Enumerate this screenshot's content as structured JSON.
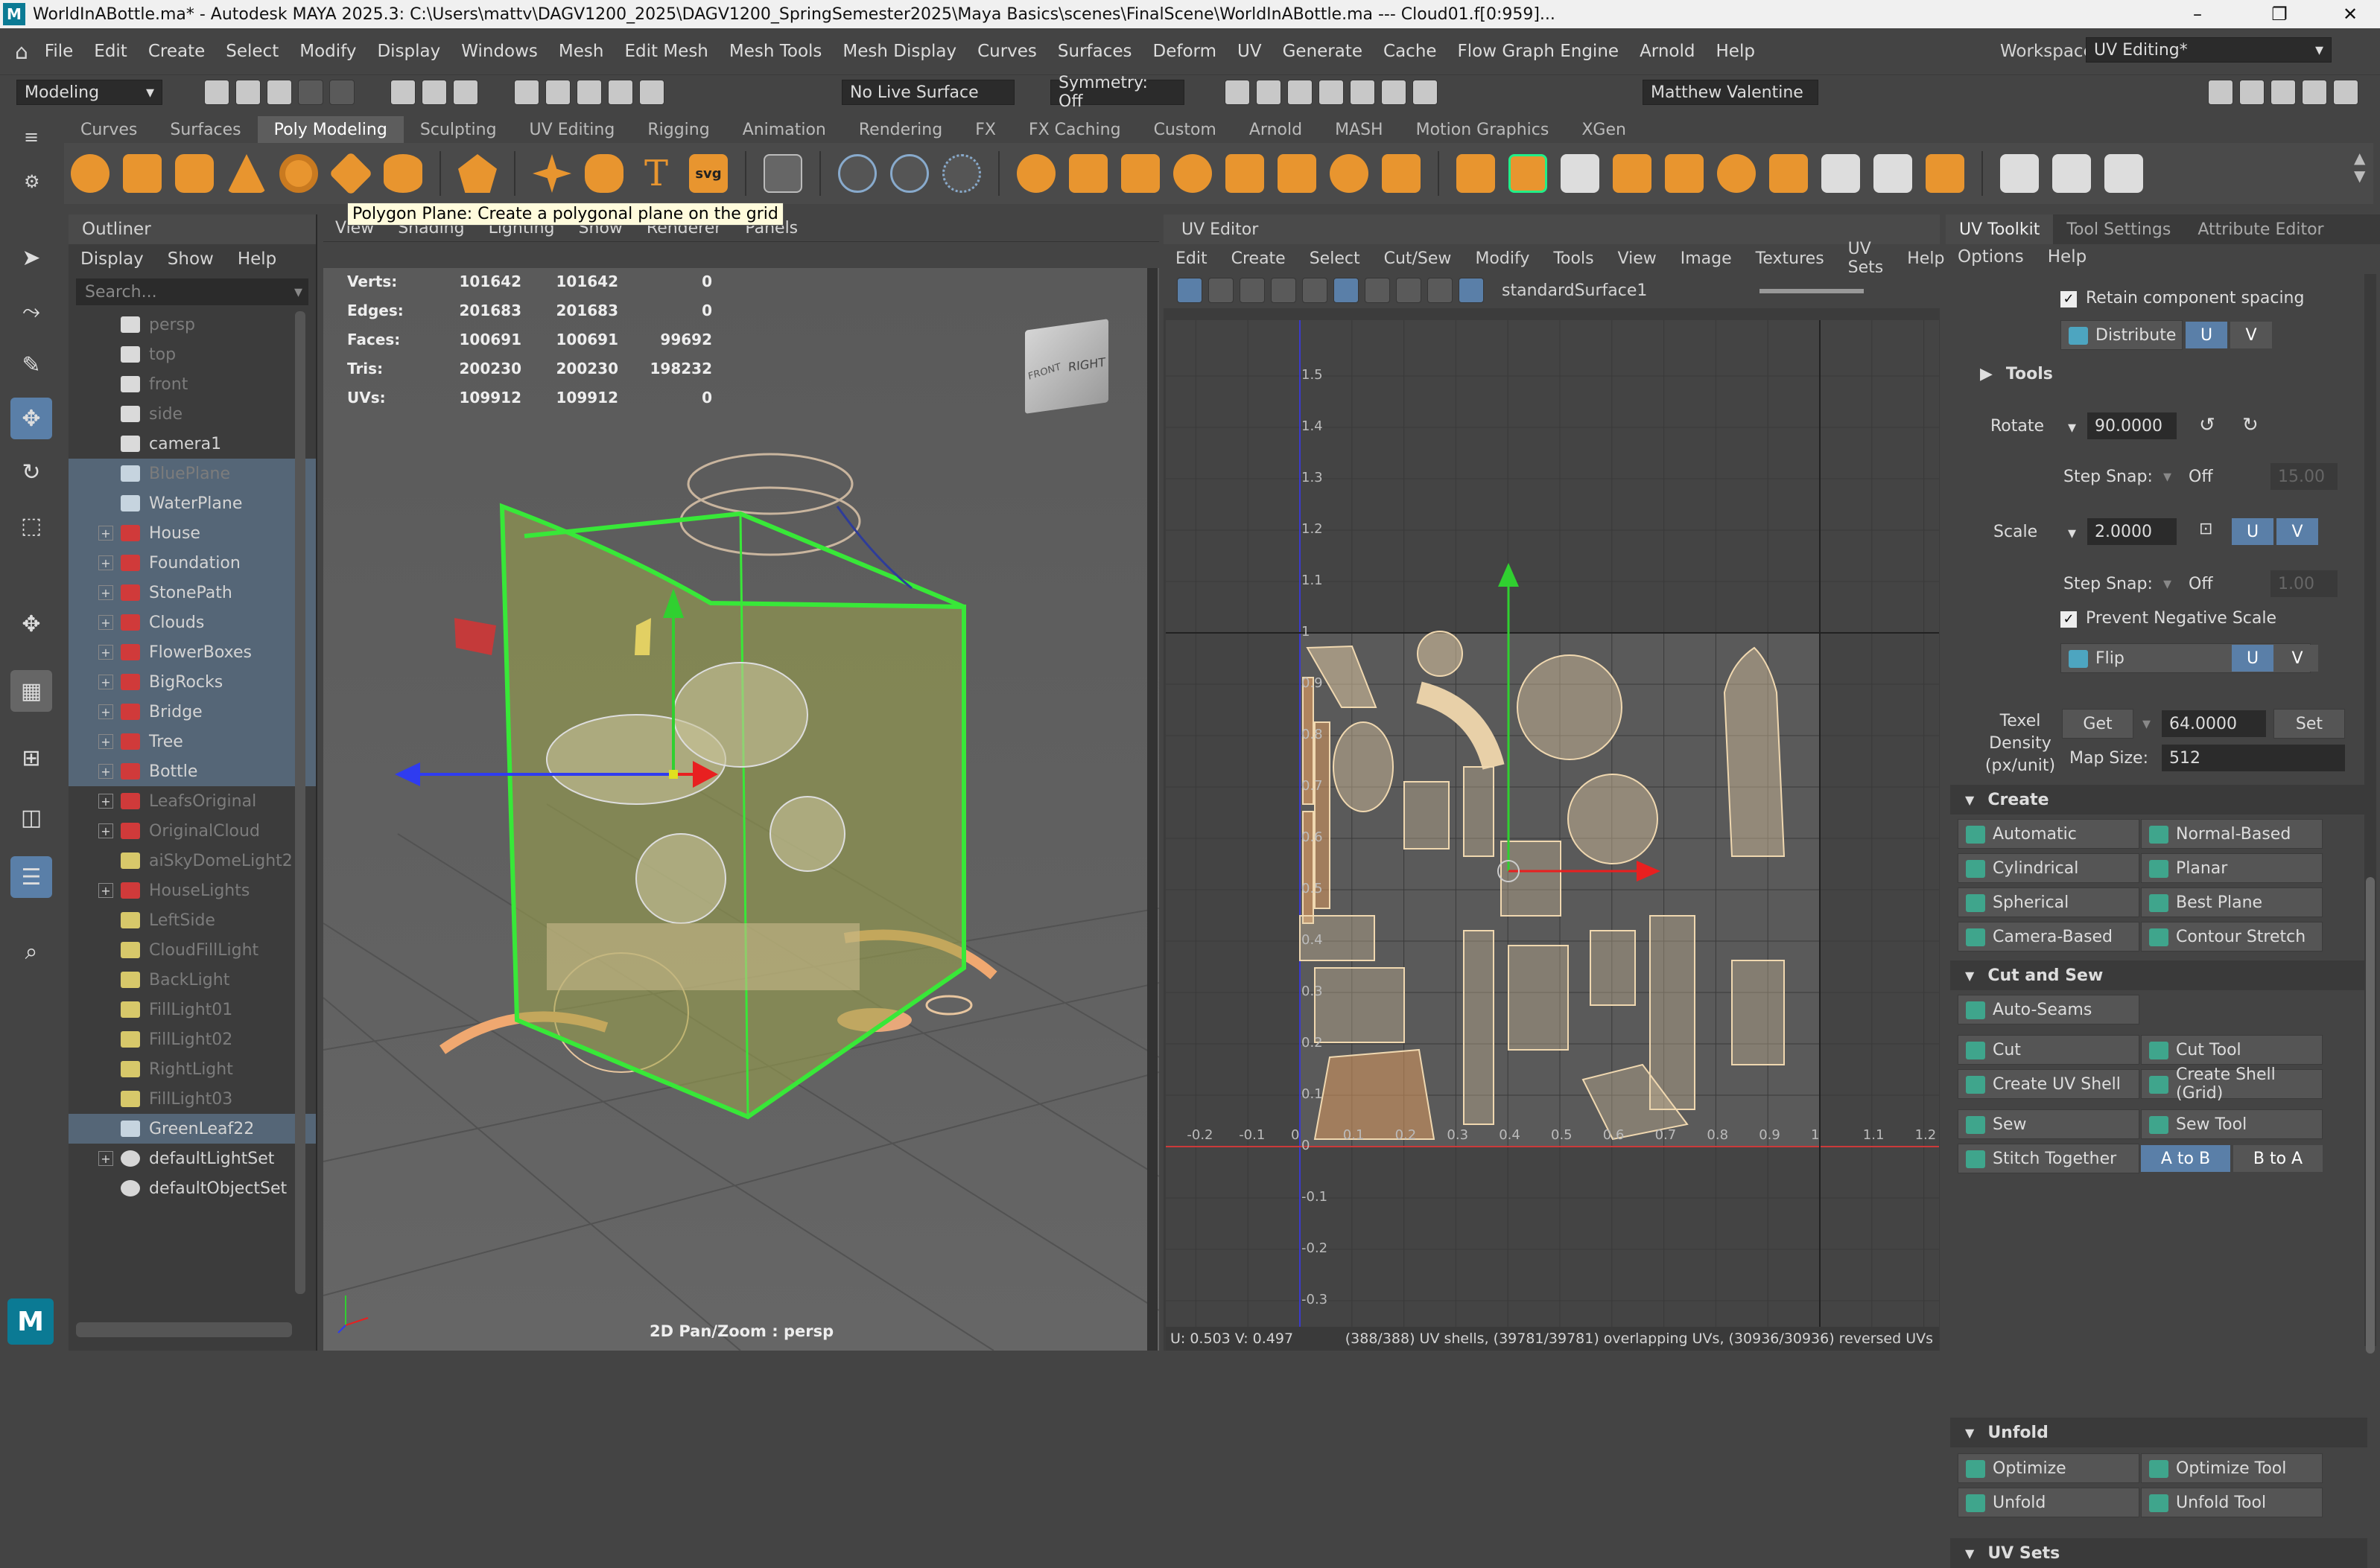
{
  "titlebar": {
    "logo": "M",
    "title": "WorldInABottle.ma* - Autodesk MAYA 2025.3: C:\\Users\\mattv\\DAGV1200_2025\\DAGV1200_SpringSemester2025\\Maya Basics\\scenes\\FinalScene\\WorldInABottle.ma   ---   Cloud01.f[0:959]...",
    "minimize": "–",
    "maximize": "❐",
    "close": "✕"
  },
  "menubar": {
    "items": [
      "File",
      "Edit",
      "Create",
      "Select",
      "Modify",
      "Display",
      "Windows",
      "Mesh",
      "Edit Mesh",
      "Mesh Tools",
      "Mesh Display",
      "Curves",
      "Surfaces",
      "Deform",
      "UV",
      "Generate",
      "Cache",
      "Flow Graph Engine",
      "Arnold",
      "Help"
    ],
    "workspace_label": "Workspace:",
    "workspace_value": "UV Editing*"
  },
  "statusline": {
    "mode": "Modeling",
    "live_surface": "No Live Surface",
    "symmetry": "Symmetry: Off",
    "user": "Matthew Valentine"
  },
  "shelf": {
    "tabs": [
      "Curves",
      "Surfaces",
      "Poly Modeling",
      "Sculpting",
      "UV Editing",
      "Rigging",
      "Animation",
      "Rendering",
      "FX",
      "FX Caching",
      "Custom",
      "Arnold",
      "MASH",
      "Motion Graphics",
      "XGen"
    ],
    "active_tab": "Poly Modeling",
    "tooltip": "Polygon Plane: Create a polygonal plane on the grid"
  },
  "outliner": {
    "title": "Outliner",
    "menu": [
      "Display",
      "Show",
      "Help"
    ],
    "search_placeholder": "Search...",
    "items": [
      {
        "label": "persp",
        "type": "camera",
        "dim": true,
        "sel": false,
        "expand": false
      },
      {
        "label": "top",
        "type": "camera",
        "dim": true,
        "sel": false,
        "expand": false
      },
      {
        "label": "front",
        "type": "camera",
        "dim": true,
        "sel": false,
        "expand": false
      },
      {
        "label": "side",
        "type": "camera",
        "dim": true,
        "sel": false,
        "expand": false
      },
      {
        "label": "camera1",
        "type": "camera",
        "dim": false,
        "sel": false,
        "expand": false
      },
      {
        "label": "BluePlane",
        "type": "mesh",
        "dim": true,
        "sel": true,
        "expand": false
      },
      {
        "label": "WaterPlane",
        "type": "mesh",
        "dim": false,
        "sel": true,
        "expand": false
      },
      {
        "label": "House",
        "type": "group",
        "dim": false,
        "sel": true,
        "expand": true
      },
      {
        "label": "Foundation",
        "type": "group",
        "dim": false,
        "sel": true,
        "expand": true
      },
      {
        "label": "StonePath",
        "type": "group",
        "dim": false,
        "sel": true,
        "expand": true
      },
      {
        "label": "Clouds",
        "type": "group",
        "dim": false,
        "sel": true,
        "expand": true
      },
      {
        "label": "FlowerBoxes",
        "type": "group",
        "dim": false,
        "sel": true,
        "expand": true
      },
      {
        "label": "BigRocks",
        "type": "group",
        "dim": false,
        "sel": true,
        "expand": true
      },
      {
        "label": "Bridge",
        "type": "group",
        "dim": false,
        "sel": true,
        "expand": true
      },
      {
        "label": "Tree",
        "type": "group",
        "dim": false,
        "sel": true,
        "expand": true
      },
      {
        "label": "Bottle",
        "type": "group",
        "dim": false,
        "sel": true,
        "expand": true
      },
      {
        "label": "LeafsOriginal",
        "type": "group",
        "dim": true,
        "sel": false,
        "expand": true
      },
      {
        "label": "OriginalCloud",
        "type": "group",
        "dim": true,
        "sel": false,
        "expand": true
      },
      {
        "label": "aiSkyDomeLight2",
        "type": "light",
        "dim": true,
        "sel": false,
        "expand": false
      },
      {
        "label": "HouseLights",
        "type": "group",
        "dim": true,
        "sel": false,
        "expand": true
      },
      {
        "label": "LeftSide",
        "type": "light",
        "dim": true,
        "sel": false,
        "expand": false
      },
      {
        "label": "CloudFillLight",
        "type": "light",
        "dim": true,
        "sel": false,
        "expand": false
      },
      {
        "label": "BackLight",
        "type": "light",
        "dim": true,
        "sel": false,
        "expand": false
      },
      {
        "label": "FillLight01",
        "type": "light",
        "dim": true,
        "sel": false,
        "expand": false
      },
      {
        "label": "FillLight02",
        "type": "light",
        "dim": true,
        "sel": false,
        "expand": false
      },
      {
        "label": "RightLight",
        "type": "light",
        "dim": true,
        "sel": false,
        "expand": false
      },
      {
        "label": "FillLight03",
        "type": "light",
        "dim": true,
        "sel": false,
        "expand": false
      },
      {
        "label": "GreenLeaf22",
        "type": "mesh",
        "dim": false,
        "sel": true,
        "expand": false
      },
      {
        "label": "defaultLightSet",
        "type": "set",
        "dim": false,
        "sel": false,
        "expand": true
      },
      {
        "label": "defaultObjectSet",
        "type": "set",
        "dim": false,
        "sel": false,
        "expand": false
      }
    ]
  },
  "viewport": {
    "menu": [
      "View",
      "Shading",
      "Lighting",
      "Show",
      "Renderer",
      "Panels"
    ],
    "hud": [
      {
        "label": "Verts:",
        "a": "101642",
        "b": "101642",
        "c": "0"
      },
      {
        "label": "Edges:",
        "a": "201683",
        "b": "201683",
        "c": "0"
      },
      {
        "label": "Faces:",
        "a": "100691",
        "b": "100691",
        "c": "99692"
      },
      {
        "label": "Tris:",
        "a": "200230",
        "b": "200230",
        "c": "198232"
      },
      {
        "label": "UVs:",
        "a": "109912",
        "b": "109912",
        "c": "0"
      }
    ],
    "cube_front": "FRONT",
    "cube_right": "RIGHT",
    "camera_label": "2D Pan/Zoom : persp"
  },
  "uv_editor": {
    "title": "UV Editor",
    "menu": [
      "Edit",
      "Create",
      "Select",
      "Cut/Sew",
      "Modify",
      "Tools",
      "View",
      "Image",
      "Textures",
      "UV Sets",
      "Help"
    ],
    "shader": "standardSurface1",
    "v_ticks": [
      "1.5",
      "1.4",
      "1.3",
      "1.2",
      "1.1",
      "1",
      "0.9",
      "0.8",
      "0.7",
      "0.6",
      "0.5",
      "0.4",
      "0.3",
      "0.2",
      "0.1",
      "0",
      "-0.1",
      "-0.2",
      "-0.3"
    ],
    "u_ticks": [
      "-0.2",
      "-0.1",
      "0",
      "0.1",
      "0.2",
      "0.3",
      "0.4",
      "0.5",
      "0.6",
      "0.7",
      "0.8",
      "0.9",
      "1",
      "1.1",
      "1.2"
    ],
    "status_uv": "U: 0.503 V: 0.497",
    "status_shells": "(388/388) UV shells, (39781/39781) overlapping UVs, (30936/30936) reversed UVs"
  },
  "toolkit": {
    "tabs": [
      "UV Toolkit",
      "Tool Settings",
      "Attribute Editor"
    ],
    "menu": [
      "Options",
      "Help"
    ],
    "retain_spacing": "Retain component spacing",
    "distribute": "Distribute",
    "u": "U",
    "v": "V",
    "tools_header": "Tools",
    "rotate_label": "Rotate",
    "rotate_value": "90.0000",
    "step_snap_label": "Step Snap:",
    "step_snap_value": "Off",
    "rotate_step": "15.00",
    "scale_label": "Scale",
    "scale_value": "2.0000",
    "scale_step": "1.00",
    "prevent_negative": "Prevent Negative Scale",
    "flip": "Flip",
    "texel_label": "Texel Density (px/unit)",
    "get": "Get",
    "texel_value": "64.0000",
    "set": "Set",
    "map_size_label": "Map Size:",
    "map_size_value": "512",
    "create_header": "Create",
    "create_buttons": [
      "Automatic",
      "Normal-Based",
      "Cylindrical",
      "Planar",
      "Spherical",
      "Best Plane",
      "Camera-Based",
      "Contour Stretch"
    ],
    "cutsew_header": "Cut and Sew",
    "auto_seams": "Auto-Seams",
    "cut": "Cut",
    "cut_tool": "Cut Tool",
    "create_uv_shell": "Create UV Shell",
    "create_shell_grid": "Create Shell (Grid)",
    "sew": "Sew",
    "sew_tool": "Sew Tool",
    "stitch_together": "Stitch Together",
    "a_to_b": "A to B",
    "b_to_a": "B to A",
    "unfold_header": "Unfold",
    "optimize": "Optimize",
    "optimize_tool": "Optimize Tool",
    "unfold": "Unfold",
    "unfold_tool": "Unfold Tool",
    "uvsets_header": "UV Sets"
  }
}
